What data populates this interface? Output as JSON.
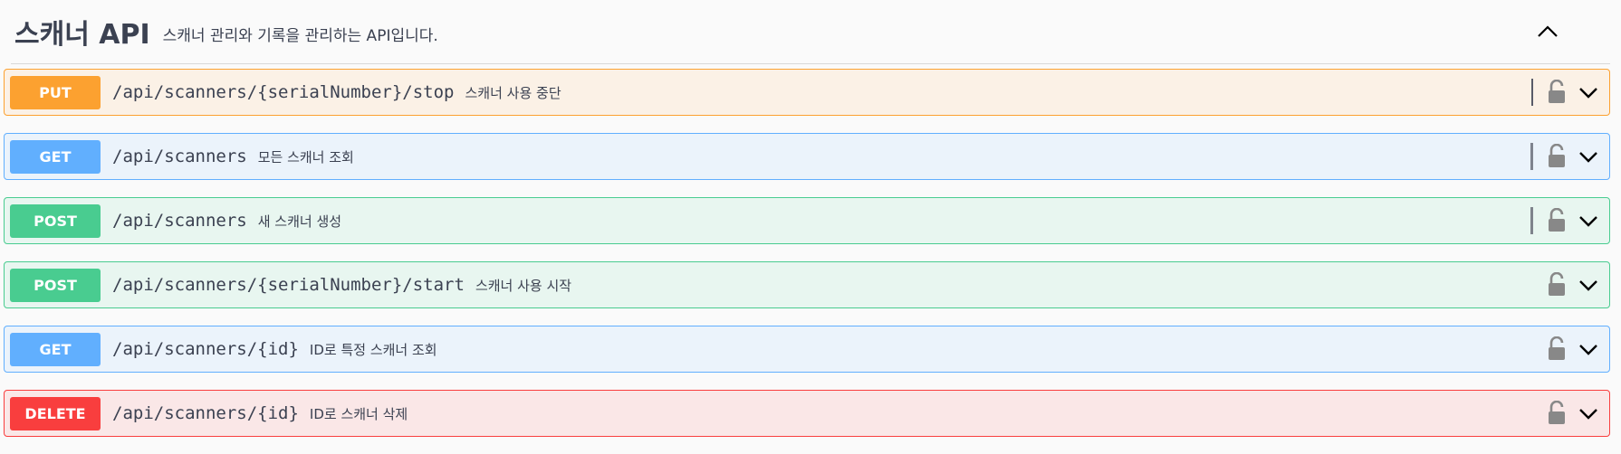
{
  "section": {
    "title": "스캐너 API",
    "description": "스캐너 관리와 기록을 관리하는 API입니다."
  },
  "operations": [
    {
      "method": "PUT",
      "path": "/api/scanners/{serialNumber}/stop",
      "summary": "스캐너 사용 중단"
    },
    {
      "method": "GET",
      "path": "/api/scanners",
      "summary": "모든 스캐너 조회"
    },
    {
      "method": "POST",
      "path": "/api/scanners",
      "summary": "새 스캐너 생성"
    },
    {
      "method": "POST",
      "path": "/api/scanners/{serialNumber}/start",
      "summary": "스캐너 사용 시작"
    },
    {
      "method": "GET",
      "path": "/api/scanners/{id}",
      "summary": "ID로 특정 스캐너 조회"
    },
    {
      "method": "DELETE",
      "path": "/api/scanners/{id}",
      "summary": "ID로 스캐너 삭제"
    }
  ],
  "icons": {
    "collapse": "chevron-up-icon",
    "lock": "unlocked-padlock-icon",
    "expand": "chevron-down-icon"
  },
  "colors": {
    "put": "#fca130",
    "get": "#61affe",
    "post": "#49cc90",
    "delete": "#f93e3e",
    "text": "#3b4151"
  }
}
